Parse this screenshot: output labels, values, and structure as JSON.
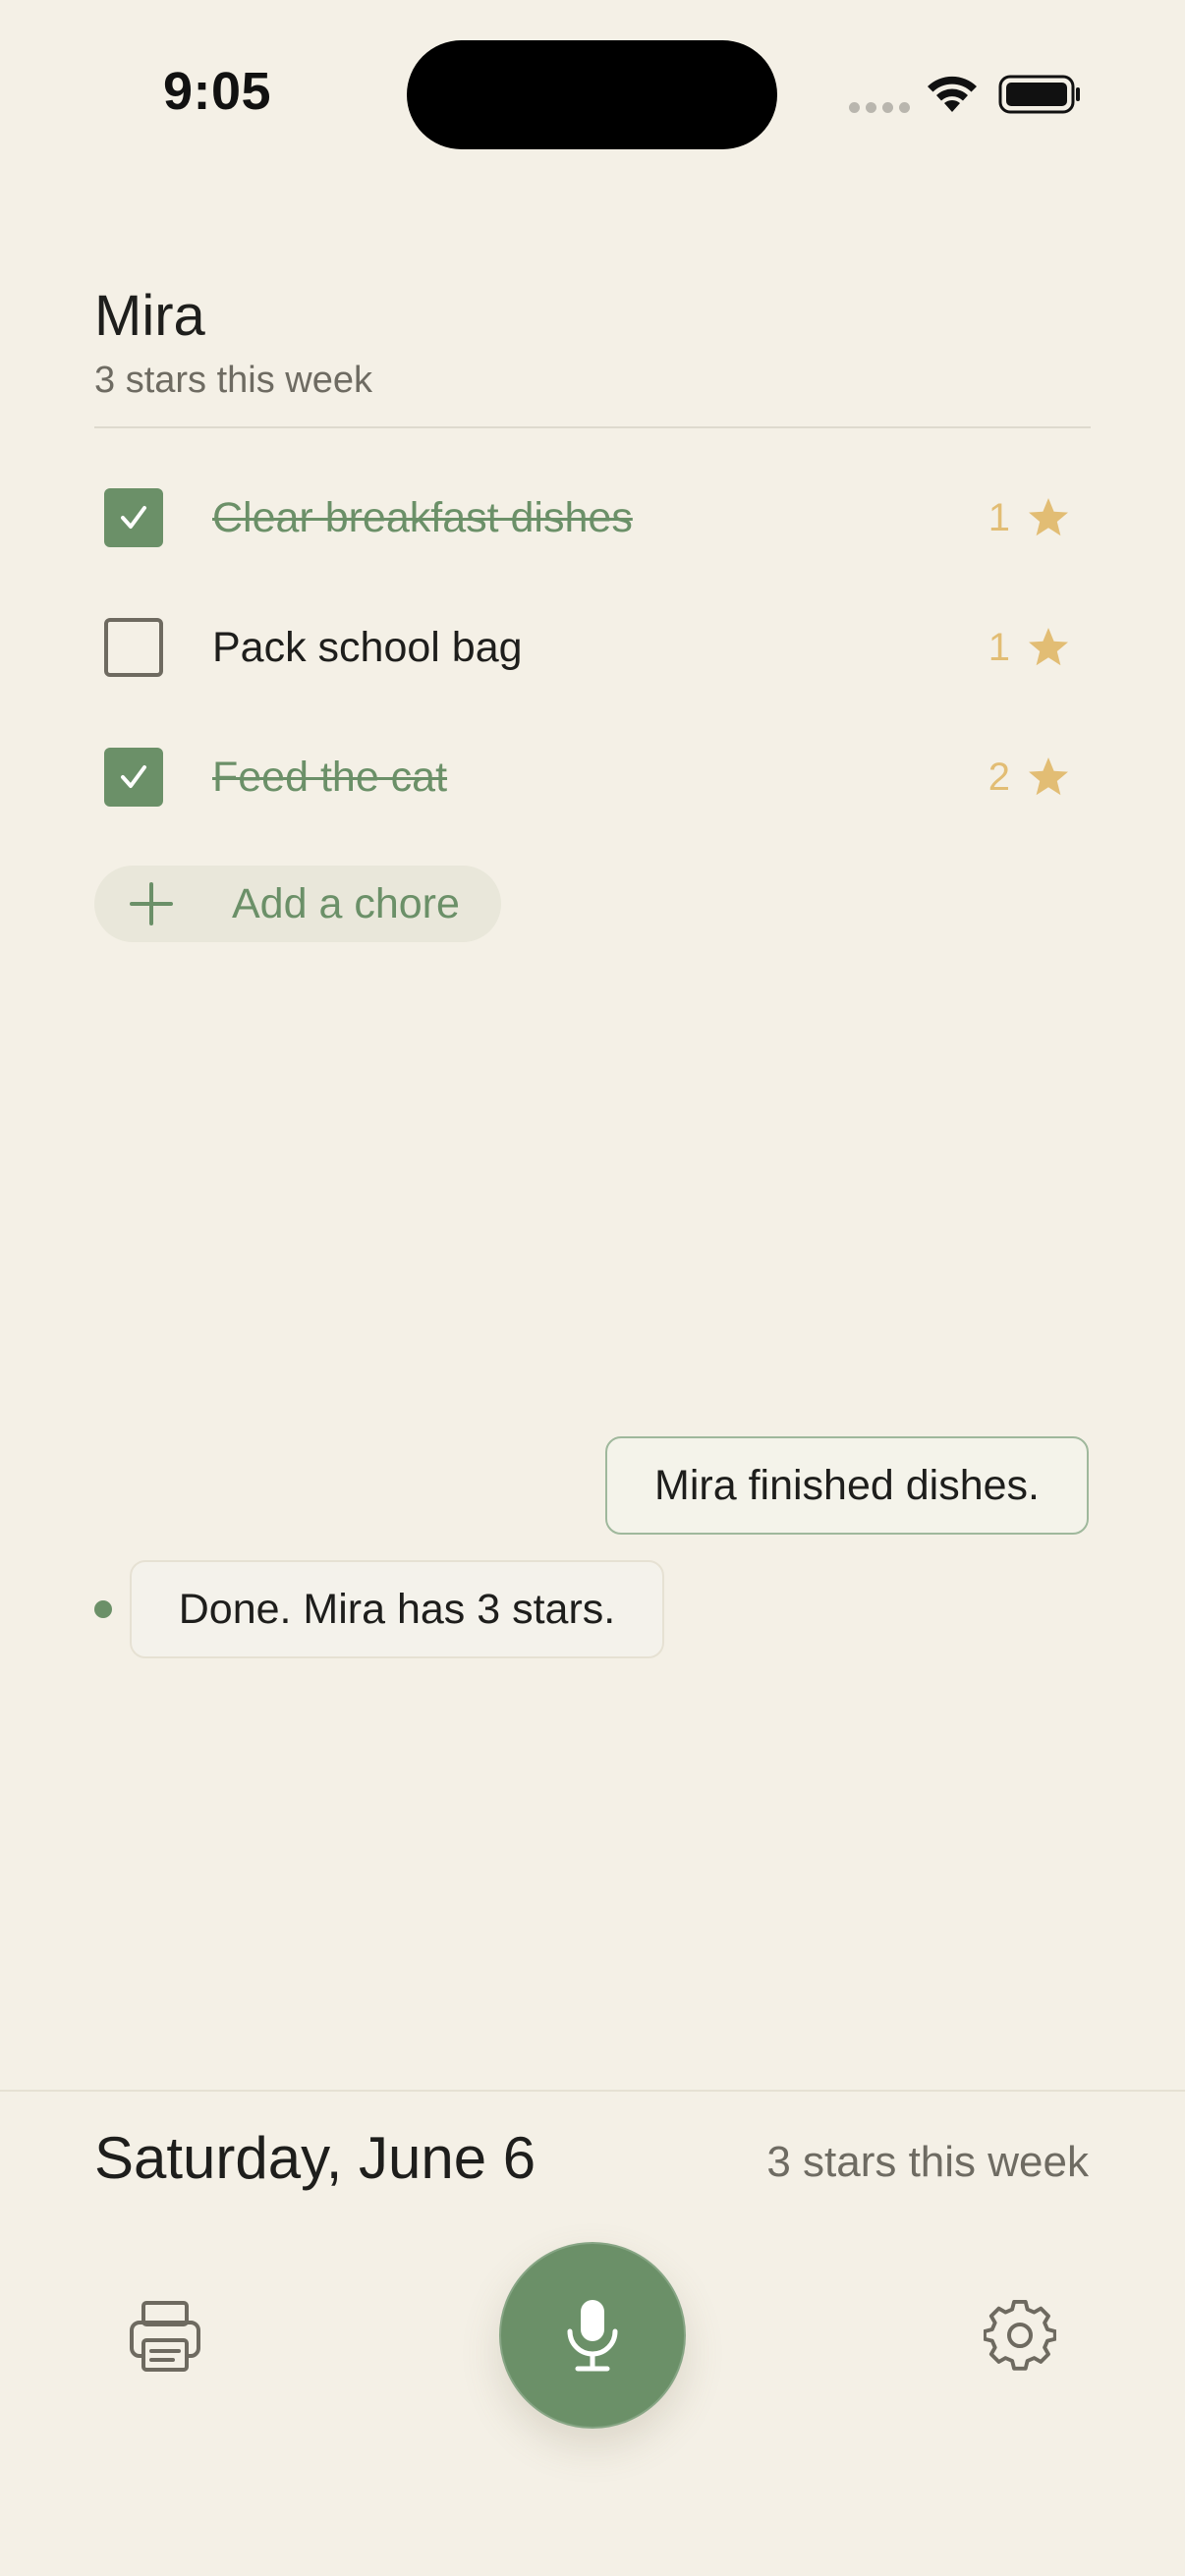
{
  "status_bar": {
    "time": "9:05"
  },
  "header": {
    "name": "Mira",
    "subtitle": "3 stars this week"
  },
  "chores": [
    {
      "label": "Clear breakfast dishes",
      "done": true,
      "stars": "1"
    },
    {
      "label": "Pack school bag",
      "done": false,
      "stars": "1"
    },
    {
      "label": "Feed the cat",
      "done": true,
      "stars": "2"
    }
  ],
  "add_chore": {
    "label": "Add a chore"
  },
  "conversation": {
    "user_message": "Mira finished dishes.",
    "assistant_message": "Done. Mira has 3 stars."
  },
  "footer": {
    "date": "Saturday, June 6",
    "stars_summary": "3 stars this week"
  },
  "toolbar": {
    "print_icon": "printer-icon",
    "mic_icon": "microphone-icon",
    "settings_icon": "gear-icon"
  },
  "colors": {
    "background": "#f4f0e6",
    "accent_green": "#6b9068",
    "star_gold": "#e2bd74",
    "muted_text": "#6e6b62"
  }
}
